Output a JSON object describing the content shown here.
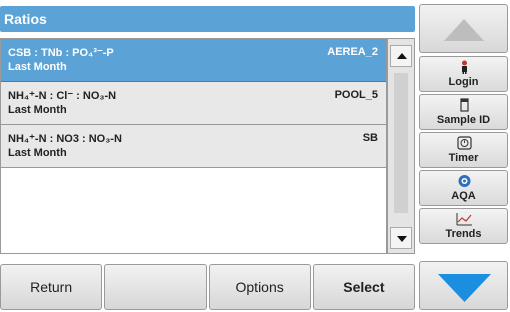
{
  "header": {
    "title": "Ratios"
  },
  "rows": [
    {
      "formula": "CSB : TNb : PO₄³⁻-P",
      "period": "Last Month",
      "location": "AEREA_2"
    },
    {
      "formula": "NH₄⁺-N : Cl⁻ : NO₃-N",
      "period": "Last Month",
      "location": "POOL_5"
    },
    {
      "formula": "NH₄⁺-N : NO3 : NO₃-N",
      "period": "Last Month",
      "location": "SB"
    }
  ],
  "bottom": {
    "return_label": "Return",
    "blank_label": "",
    "options_label": "Options",
    "select_label": "Select"
  },
  "sidebar": {
    "login_label": "Login",
    "sample_id_label": "Sample ID",
    "timer_label": "Timer",
    "aqa_label": "AQA",
    "trends_label": "Trends"
  },
  "colors": {
    "accent": "#5ba3d7",
    "arrow_blue": "#1c8ee0"
  },
  "icons": [
    "person-icon",
    "sample-vial-icon",
    "timer-icon",
    "aqa-icon",
    "trends-chart-icon",
    "scroll-up-icon",
    "scroll-down-icon",
    "arrow-up-icon",
    "arrow-down-icon"
  ]
}
